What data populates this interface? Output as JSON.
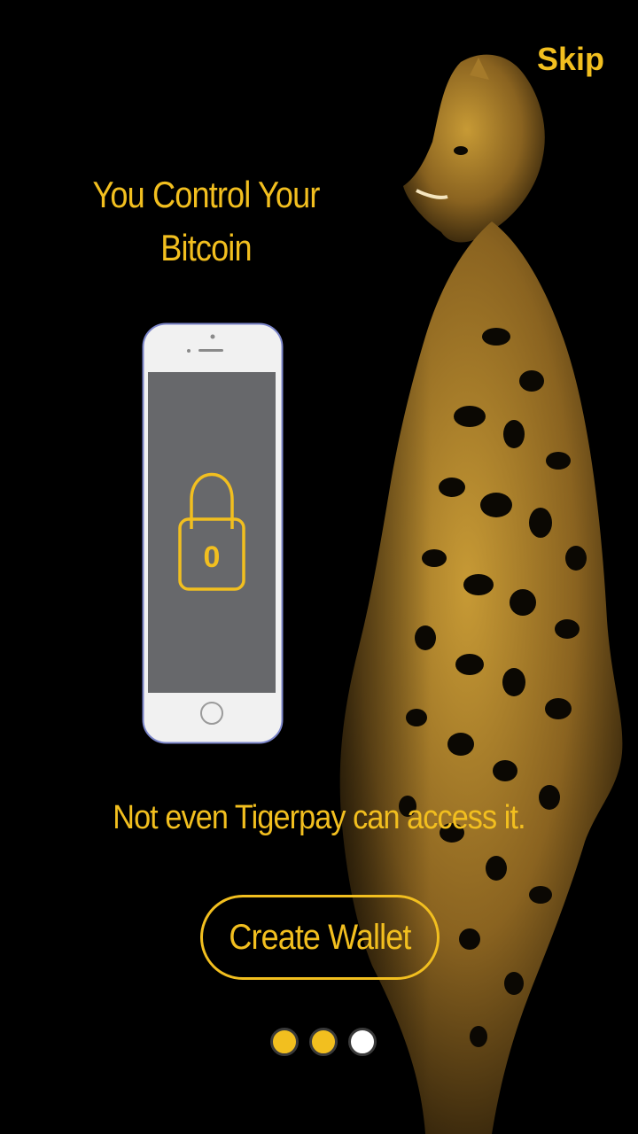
{
  "header": {
    "skip_label": "Skip"
  },
  "onboarding": {
    "headline": "You Control Your Bitcoin",
    "tagline": "Not even Tigerpay can access it.",
    "lock_icon": "padlock-icon",
    "lock_digit": "0",
    "create_wallet_label": "Create Wallet"
  },
  "pager": {
    "total_pages": 3,
    "active_color": "#f2bf1f",
    "inactive_color": "#ffffff"
  },
  "colors": {
    "accent": "#f2bf1f",
    "background": "#000000",
    "phone_screen": "#67686b",
    "phone_body": "#f1f1f1"
  }
}
